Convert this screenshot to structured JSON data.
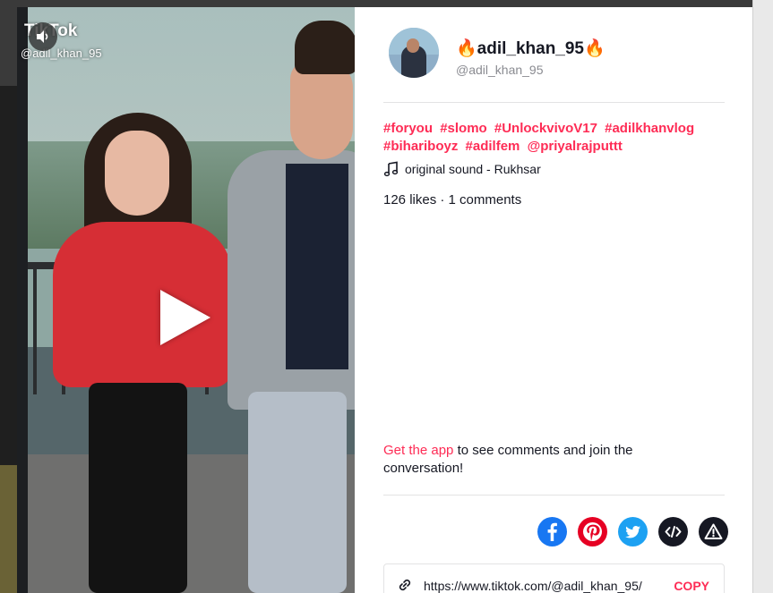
{
  "watermark": {
    "logo": "TikTok",
    "handle": "@adil_khan_95"
  },
  "author": {
    "display_name": "🔥adil_khan_95🔥",
    "username": "@adil_khan_95"
  },
  "caption_tags": [
    "#foryou",
    "#slomo",
    "#UnlockvivoV17",
    "#adilkhanvlog",
    "#bihariboyz",
    "#adilfem",
    "@priyalrajputtt"
  ],
  "sound": "original sound - Rukhsar",
  "stats": "126 likes · 1 comments",
  "get_app": {
    "link": "Get the app",
    "rest": " to see comments and join the conversation!"
  },
  "share": {
    "icons": [
      "facebook-icon",
      "pinterest-icon",
      "twitter-icon",
      "embed-icon",
      "report-icon"
    ],
    "colors": {
      "facebook": "#1877f2",
      "pinterest": "#e60023",
      "twitter": "#1da1f2",
      "embed": "#161823",
      "report": "#161823"
    }
  },
  "link_box": {
    "url": "https://www.tiktok.com/@adil_khan_95/",
    "copy_label": "COPY"
  },
  "accent_color": "#fe2c55"
}
